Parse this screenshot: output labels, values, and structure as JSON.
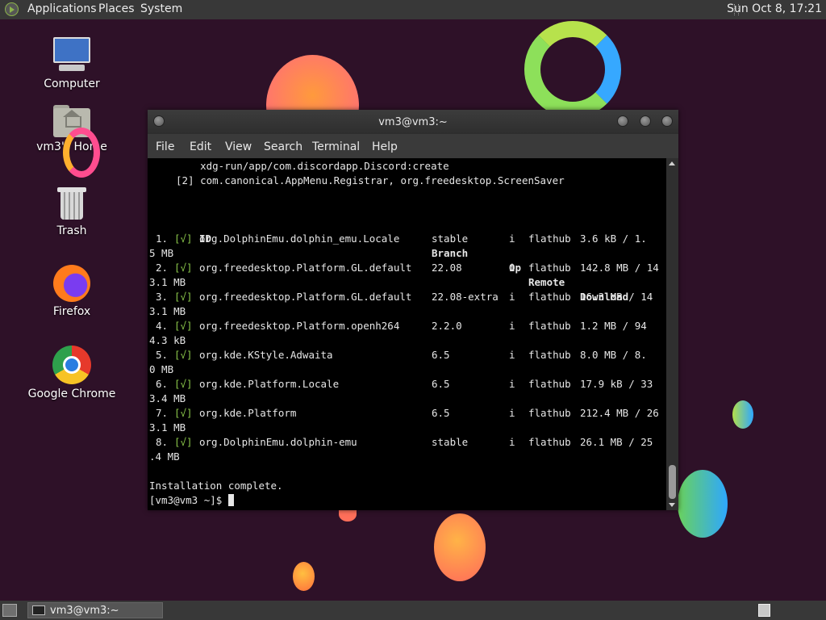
{
  "top_panel": {
    "menu": [
      "Applications",
      "Places",
      "System"
    ],
    "clock": "Sun Oct  8, 17:21"
  },
  "desktop_icons": [
    {
      "label": "Computer",
      "icon": "computer-icon"
    },
    {
      "label": "vm3's Home",
      "icon": "home-folder-icon"
    },
    {
      "label": "Trash",
      "icon": "trash-icon"
    },
    {
      "label": "Firefox",
      "icon": "firefox-icon"
    },
    {
      "label": "Google Chrome",
      "icon": "chrome-icon"
    }
  ],
  "terminal": {
    "title": "vm3@vm3:~",
    "menu": [
      "File",
      "Edit",
      "View",
      "Search",
      "Terminal",
      "Help"
    ],
    "lines": [
      "    xdg-run/app/com.discordapp.Discord:create",
      "[2] com.canonical.AppMenu.Registrar, org.freedesktop.ScreenSaver"
    ],
    "table_header": {
      "id": "ID",
      "branch": "Branch",
      "op": "Op",
      "remote": "Remote",
      "download": "Download"
    },
    "rows": [
      {
        "num": "1.",
        "check": "[√]",
        "id": "org.DolphinEmu.dolphin_emu.Locale",
        "branch": "stable",
        "op": "i",
        "remote": "flathub",
        "download": "3.6 kB / 1.",
        "wrap": "5 MB"
      },
      {
        "num": "2.",
        "check": "[√]",
        "id": "org.freedesktop.Platform.GL.default",
        "branch": "22.08",
        "op": "i",
        "remote": "flathub",
        "download": "142.8 MB / 14",
        "wrap": "3.1 MB"
      },
      {
        "num": "3.",
        "check": "[√]",
        "id": "org.freedesktop.Platform.GL.default",
        "branch": "22.08-extra",
        "op": "i",
        "remote": "flathub",
        "download": "16.3 MB / 14",
        "wrap": "3.1 MB"
      },
      {
        "num": "4.",
        "check": "[√]",
        "id": "org.freedesktop.Platform.openh264",
        "branch": "2.2.0",
        "op": "i",
        "remote": "flathub",
        "download": "1.2 MB / 94",
        "wrap": "4.3 kB"
      },
      {
        "num": "5.",
        "check": "[√]",
        "id": "org.kde.KStyle.Adwaita",
        "branch": "6.5",
        "op": "i",
        "remote": "flathub",
        "download": "8.0 MB / 8.",
        "wrap": "0 MB"
      },
      {
        "num": "6.",
        "check": "[√]",
        "id": "org.kde.Platform.Locale",
        "branch": "6.5",
        "op": "i",
        "remote": "flathub",
        "download": "17.9 kB / 33",
        "wrap": "3.4 MB"
      },
      {
        "num": "7.",
        "check": "[√]",
        "id": "org.kde.Platform",
        "branch": "6.5",
        "op": "i",
        "remote": "flathub",
        "download": "212.4 MB / 26",
        "wrap": "3.1 MB"
      },
      {
        "num": "8.",
        "check": "[√]",
        "id": "org.DolphinEmu.dolphin-emu",
        "branch": "stable",
        "op": "i",
        "remote": "flathub",
        "download": "26.1 MB / 25",
        "wrap": ".4 MB"
      }
    ],
    "status": "Installation complete.",
    "prompt": "[vm3@vm3 ~]$ "
  },
  "taskbar": {
    "task_label": "vm3@vm3:~"
  }
}
